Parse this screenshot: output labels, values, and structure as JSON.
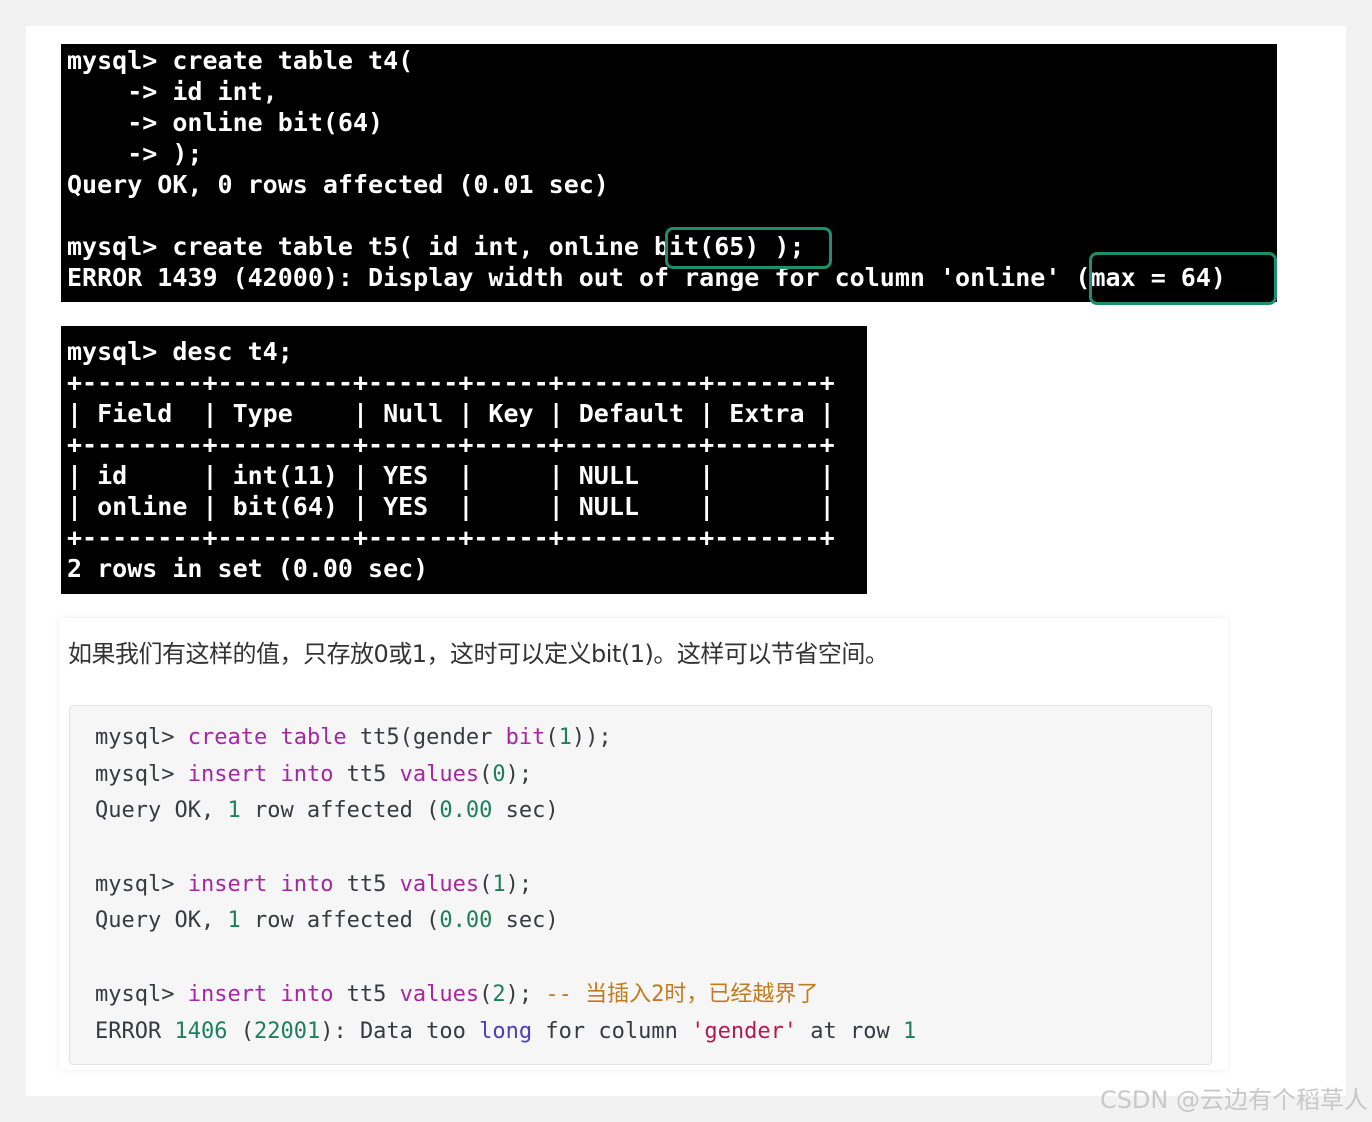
{
  "terminal1": {
    "lines": [
      "mysql> create table t4(",
      "    -> id int,",
      "    -> online bit(64)",
      "    -> );",
      "Query OK, 0 rows affected (0.01 sec)",
      "",
      "mysql> create table t5( id int, online bit(65) );",
      "ERROR 1439 (42000): Display width out of range for column 'online' (max = 64)"
    ]
  },
  "terminal2": {
    "lines": [
      "mysql> desc t4;",
      "+--------+---------+------+-----+---------+-------+",
      "| Field  | Type    | Null | Key | Default | Extra |",
      "+--------+---------+------+-----+---------+-------+",
      "| id     | int(11) | YES  |     | NULL    |       |",
      "| online | bit(64) | YES  |     | NULL    |       |",
      "+--------+---------+------+-----+---------+-------+",
      "2 rows in set (0.00 sec)"
    ]
  },
  "note": {
    "text": "如果我们有这样的值，只存放0或1，这时可以定义bit(1)。这样可以节省空间。"
  },
  "code": {
    "l1": {
      "p": "mysql> ",
      "k1": "create",
      "s1": " ",
      "k2": "table",
      "t1": " tt5(gender ",
      "k3": "bit",
      "t2": "(",
      "n1": "1",
      "t3": "));"
    },
    "l2": {
      "p": "mysql> ",
      "k1": "insert",
      "s1": " ",
      "k2": "into",
      "t1": " tt5 ",
      "k3": "values",
      "t2": "(",
      "n1": "0",
      "t3": ");"
    },
    "l3": {
      "t1": "Query OK, ",
      "n1": "1",
      "t2": " row affected (",
      "n2": "0.00",
      "t3": " sec)"
    },
    "l4": {
      "p": "mysql> ",
      "k1": "insert",
      "s1": " ",
      "k2": "into",
      "t1": " tt5 ",
      "k3": "values",
      "t2": "(",
      "n1": "1",
      "t3": ");"
    },
    "l5": {
      "t1": "Query OK, ",
      "n1": "1",
      "t2": " row affected (",
      "n2": "0.00",
      "t3": " sec)"
    },
    "l6": {
      "p": "mysql> ",
      "k1": "insert",
      "s1": " ",
      "k2": "into",
      "t1": " tt5 ",
      "k3": "values",
      "t2": "(",
      "n1": "2",
      "t3": "); ",
      "c1": "-- 当插入2时，已经越界了"
    },
    "l7": {
      "t1": "ERROR ",
      "n1": "1406",
      "t2": " (",
      "n2": "22001",
      "t3": "): Data too ",
      "k1": "long",
      "t4": " for column ",
      "s1": "'gender'",
      "t5": " at row ",
      "n3": "1"
    }
  },
  "watermark": "CSDN @云边有个稻草人",
  "colors": {
    "terminal_bg": "#000000",
    "terminal_fg": "#ffffff",
    "highlight": "#1e8e6e",
    "keyword": "#a626a4",
    "number": "#1f7f5c",
    "string": "#b51a4f",
    "comment": "#c47a1a"
  }
}
